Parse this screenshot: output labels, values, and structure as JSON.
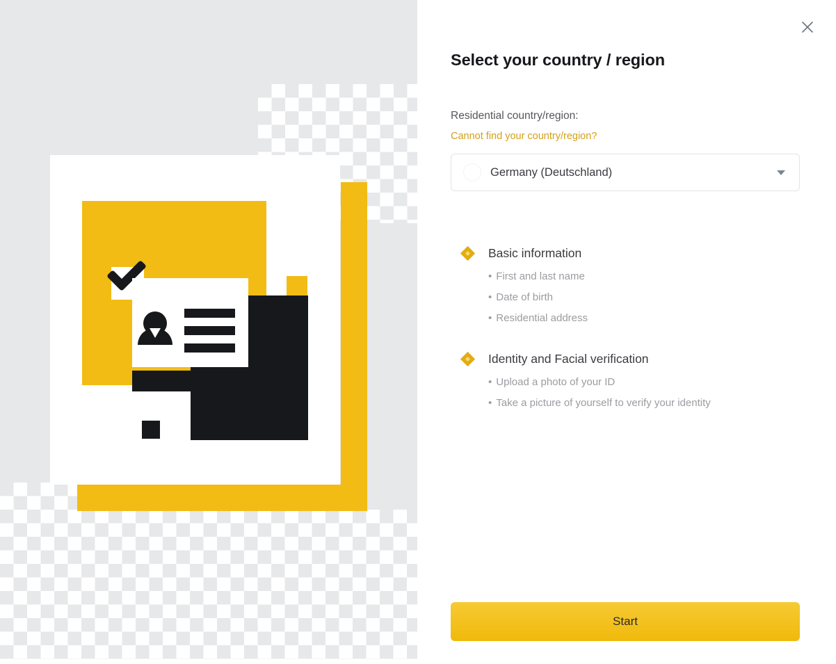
{
  "window": {
    "close_icon": "close-icon"
  },
  "panel": {
    "title": "Select your country / region",
    "field_label": "Residential country/region:",
    "help_link": "Cannot find your country/region?"
  },
  "country_select": {
    "selected": "Germany (Deutschland)",
    "flag_icon": "germany-flag-icon",
    "caret_icon": "chevron-down-icon",
    "options": [
      "Germany (Deutschland)"
    ]
  },
  "checklist": [
    {
      "title": "Basic information",
      "bullet_icon": "diamond-icon",
      "items": [
        "First and last name",
        "Date of birth",
        "Residential address"
      ]
    },
    {
      "title": "Identity and Facial verification",
      "bullet_icon": "diamond-icon",
      "items": [
        "Upload a photo of your ID",
        "Take a picture of yourself to verify your identity"
      ]
    }
  ],
  "bullet_char": "•",
  "actions": {
    "start_label": "Start"
  },
  "illustration": {
    "name": "identity-verification-illustration",
    "check_icon": "checkmark-icon",
    "card_icon": "id-card-icon",
    "avatar_icon": "person-icon"
  },
  "colors": {
    "brand_yellow": "#f0b90b",
    "illustration_yellow": "#f2bc15",
    "link_gold": "#d4a017",
    "dark": "#17181c",
    "panel_gray": "#e7e8ea",
    "border": "#e2e3e5",
    "muted_text": "#9b9ca1"
  }
}
